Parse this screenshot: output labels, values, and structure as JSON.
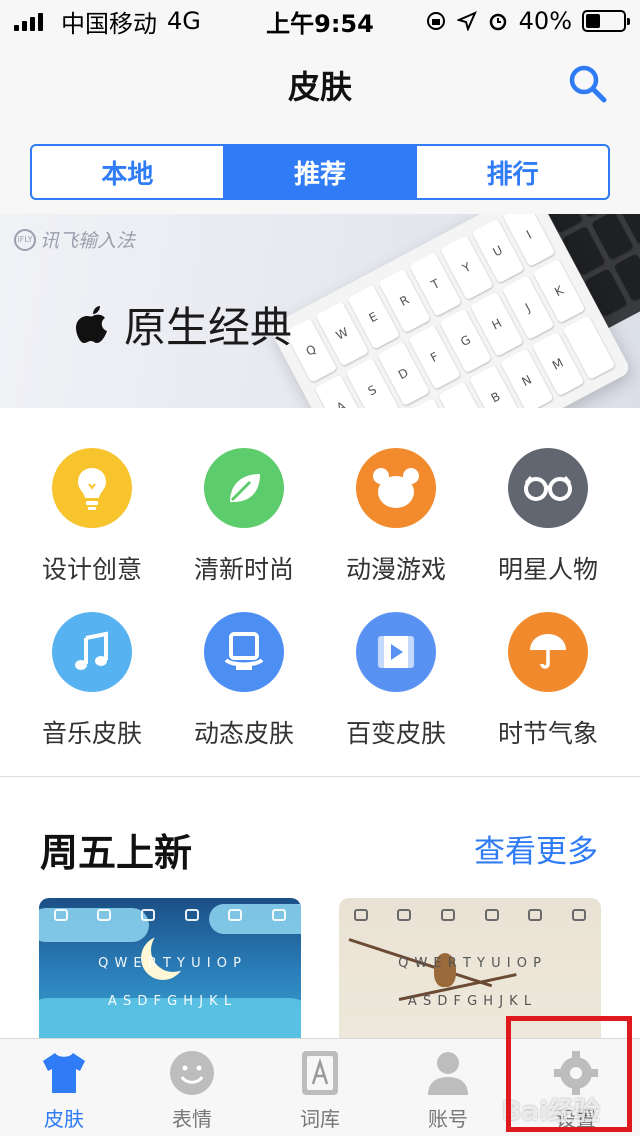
{
  "status_bar": {
    "carrier": "中国移动",
    "network": "4G",
    "time": "上午9:54",
    "battery": "40%",
    "battery_level": 0.4
  },
  "header": {
    "title": "皮肤",
    "search_icon": "search-icon"
  },
  "segments": [
    {
      "label": "本地",
      "active": false
    },
    {
      "label": "推荐",
      "active": true
    },
    {
      "label": "排行",
      "active": false
    }
  ],
  "banner": {
    "brand": "讯飞输入法",
    "brand_mark": "iFLY",
    "title": "原生经典",
    "logo_icon": "apple-icon"
  },
  "categories": [
    {
      "label": "设计创意",
      "icon": "lightbulb-icon",
      "color": "#f7c42e"
    },
    {
      "label": "清新时尚",
      "icon": "leaf-icon",
      "color": "#5dcc6c"
    },
    {
      "label": "动漫游戏",
      "icon": "bear-icon",
      "color": "#f28a2e"
    },
    {
      "label": "明星人物",
      "icon": "glasses-icon",
      "color": "#616670"
    },
    {
      "label": "音乐皮肤",
      "icon": "music-note-icon",
      "color": "#56b2f1"
    },
    {
      "label": "动态皮肤",
      "icon": "animated-screen-icon",
      "color": "#4c8ef2"
    },
    {
      "label": "百变皮肤",
      "icon": "video-play-icon",
      "color": "#5a92f2"
    },
    {
      "label": "时节气象",
      "icon": "umbrella-icon",
      "color": "#f08a2c"
    }
  ],
  "new_section": {
    "title": "周五上新",
    "see_more": "查看更多",
    "cards": [
      {
        "name": "night-sky-skin",
        "row1": "Q W E R T Y U I O P",
        "row2": "A S D F G H J K L"
      },
      {
        "name": "ink-bird-skin",
        "row1": "Q W E R T Y U I O P",
        "row2": "A S D F G H J K L"
      }
    ]
  },
  "tabbar": {
    "items": [
      {
        "label": "皮肤",
        "icon": "tshirt-icon",
        "active": true
      },
      {
        "label": "表情",
        "icon": "emoji-icon",
        "active": false
      },
      {
        "label": "词库",
        "icon": "dictionary-icon",
        "active": false
      },
      {
        "label": "账号",
        "icon": "person-icon",
        "active": false
      },
      {
        "label": "设置",
        "icon": "gear-icon",
        "active": false
      }
    ]
  },
  "watermark": "Bai经验",
  "colors": {
    "accent": "#2f7cf6",
    "highlight": "#e0191f"
  }
}
